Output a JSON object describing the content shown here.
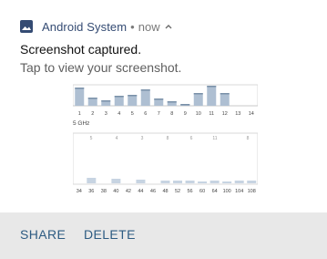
{
  "notification": {
    "app_name": "Android System",
    "separator": "•",
    "time": "now",
    "icon": "image-icon",
    "chevron_icon": "chevron-up-icon",
    "title": "Screenshot captured.",
    "text": "Tap to view your screenshot."
  },
  "preview": {
    "top_ticks": [
      "1",
      "2",
      "3",
      "4",
      "5",
      "6",
      "7",
      "8",
      "9",
      "10",
      "11",
      "12",
      "13",
      "14"
    ],
    "band_label": "5 GHz",
    "inner_labels": [
      "5",
      "4",
      "3",
      "8",
      "6",
      "11",
      "8"
    ],
    "bottom_ticks": [
      "34",
      "36",
      "38",
      "40",
      "42",
      "44",
      "46",
      "48",
      "52",
      "56",
      "60",
      "64",
      "100",
      "104",
      "108"
    ]
  },
  "actions": {
    "share": "SHARE",
    "delete": "DELETE"
  }
}
